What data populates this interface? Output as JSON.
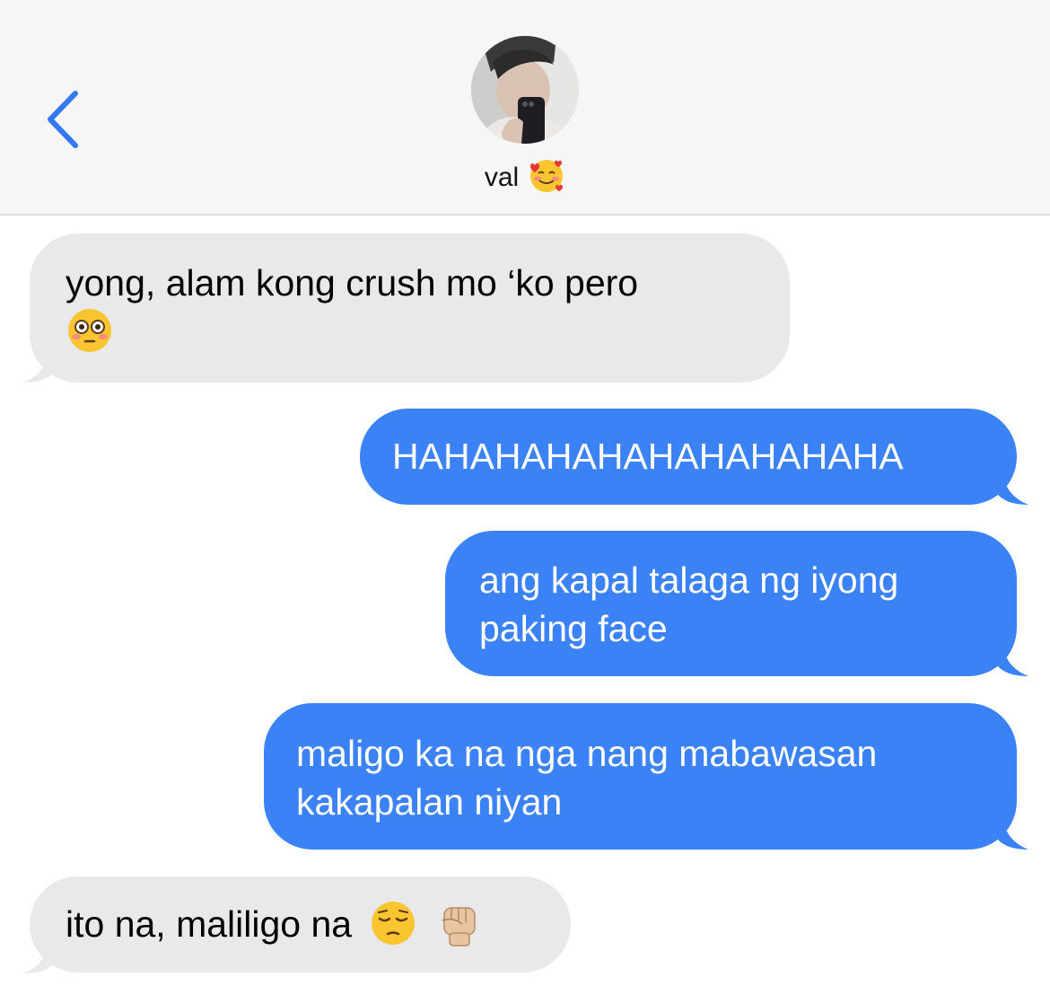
{
  "header": {
    "contact_name": "val",
    "name_emoji": "smiling-face-with-hearts-icon"
  },
  "colors": {
    "accent": "#3b82f6",
    "received_bubble": "#e9e9eb",
    "header_bg": "#f6f6f6"
  },
  "messages": [
    {
      "direction": "received",
      "text": "yong, alam kong crush mo ‘ko pero",
      "emoji": [
        "flushed-face-icon"
      ]
    },
    {
      "direction": "sent",
      "text": "HAHAHAHAHAHAHAHAHAHA"
    },
    {
      "direction": "sent",
      "text": "ang kapal talaga ng iyong paking face"
    },
    {
      "direction": "sent",
      "text": "maligo ka na nga nang mabawasan kakapalan niyan"
    },
    {
      "direction": "received",
      "text": "ito na, maliligo na",
      "emoji": [
        "pensive-face-icon",
        "raised-fist-icon"
      ]
    }
  ]
}
